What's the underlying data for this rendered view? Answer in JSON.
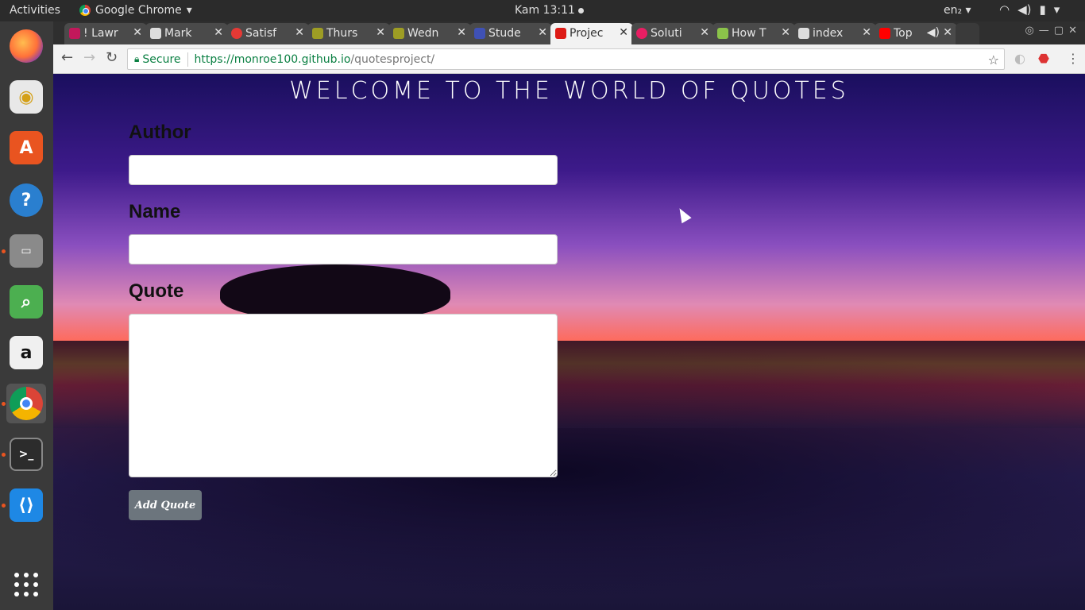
{
  "system": {
    "activities": "Activities",
    "app_name": "Google Chrome",
    "clock": "Kam 13:11",
    "language": "en₂"
  },
  "tabs": [
    {
      "label": "! Lawr",
      "favicon_color": "#c2185b"
    },
    {
      "label": "Mark",
      "favicon_color": "#dddddd"
    },
    {
      "label": "Satisf",
      "favicon_color": "#e53935"
    },
    {
      "label": "Thurs",
      "favicon_color": "#9e9d24"
    },
    {
      "label": "Wedn",
      "favicon_color": "#9e9d24"
    },
    {
      "label": "Stude",
      "favicon_color": "#3f51b5"
    },
    {
      "label": "Projec",
      "favicon_color": "#dd1b16"
    },
    {
      "label": "Soluti",
      "favicon_color": "#e91e63"
    },
    {
      "label": "How T",
      "favicon_color": "#8bc34a"
    },
    {
      "label": "index",
      "favicon_color": "#dddddd"
    },
    {
      "label": "Top",
      "favicon_color": "#ff0000"
    }
  ],
  "address": {
    "secure_label": "Secure",
    "url_host": "https://monroe100.github.io",
    "url_path": "/quotesproject/"
  },
  "page": {
    "title": "WELCOME TO THE WORLD OF QUOTES",
    "author_label": "Author",
    "name_label": "Name",
    "quote_label": "Quote",
    "author_value": "",
    "name_value": "",
    "quote_value": "",
    "add_button": "Add Quote"
  },
  "dock": [
    "firefox-icon",
    "rhythmbox-icon",
    "software-center-icon",
    "help-icon",
    "files-icon",
    "image-viewer-icon",
    "amazon-icon",
    "chrome-icon",
    "terminal-icon",
    "vscode-icon",
    "app-grid-icon"
  ],
  "colors": {
    "button_bg": "#6c757d",
    "secure_green": "#0b8043"
  }
}
